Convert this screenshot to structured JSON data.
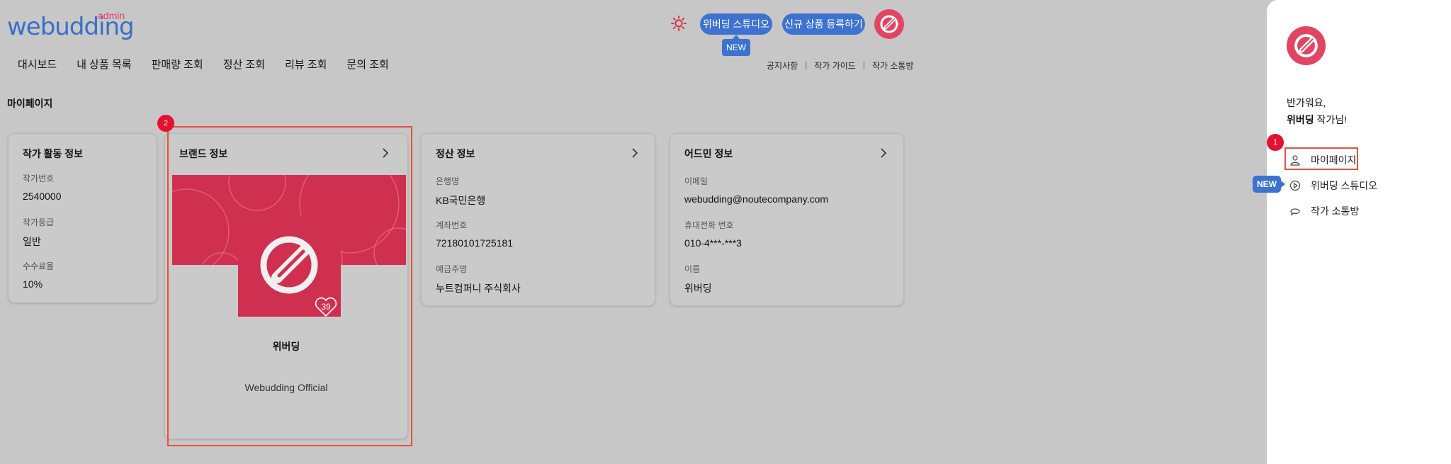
{
  "header": {
    "logo_text": "webudding",
    "logo_sub": "admin",
    "studio_button": "위버딩 스튜디오",
    "new_tip": "NEW",
    "register_button": "신규 상품 등록하기"
  },
  "nav": {
    "items": [
      "대시보드",
      "내 상품 목록",
      "판매량 조회",
      "정산 조회",
      "리뷰 조회",
      "문의 조회"
    ],
    "links": [
      "공지사항",
      "작가 가이드",
      "작가 소통방"
    ]
  },
  "page_title": "마이페이지",
  "artist_card": {
    "title": "작가 활동 정보",
    "fields": [
      {
        "label": "작가번호",
        "value": "2540000"
      },
      {
        "label": "작가등급",
        "value": "일반"
      },
      {
        "label": "수수료율",
        "value": "10%"
      }
    ]
  },
  "brand_card": {
    "title": "브랜드 정보",
    "likes": "39",
    "name": "위버딩",
    "subtitle": "Webudding Official",
    "badge": "2"
  },
  "settlement_card": {
    "title": "정산 정보",
    "fields": [
      {
        "label": "은행명",
        "value": "KB국민은행"
      },
      {
        "label": "계좌번호",
        "value": "72180101725181"
      },
      {
        "label": "예금주명",
        "value": "누트컴퍼니 주식회사"
      }
    ]
  },
  "admin_card": {
    "title": "어드민 정보",
    "fields": [
      {
        "label": "이메일",
        "value": "webudding@noutecompany.com"
      },
      {
        "label": "휴대전화 번호",
        "value": "010-4***-***3"
      },
      {
        "label": "이름",
        "value": "위버딩"
      }
    ]
  },
  "panel": {
    "greeting": "반가워요,",
    "name": "위버딩",
    "name_suffix": " 작가님!",
    "badge": "1",
    "new_tag": "NEW",
    "menu": [
      "마이페이지",
      "위버딩 스튜디오",
      "작가 소통방"
    ],
    "icons": [
      "user-icon",
      "play-circle-icon",
      "chat-icon"
    ]
  },
  "colors": {
    "accent": "#3d73cf",
    "brand": "#d0304f",
    "highlight": "#e8503c"
  }
}
